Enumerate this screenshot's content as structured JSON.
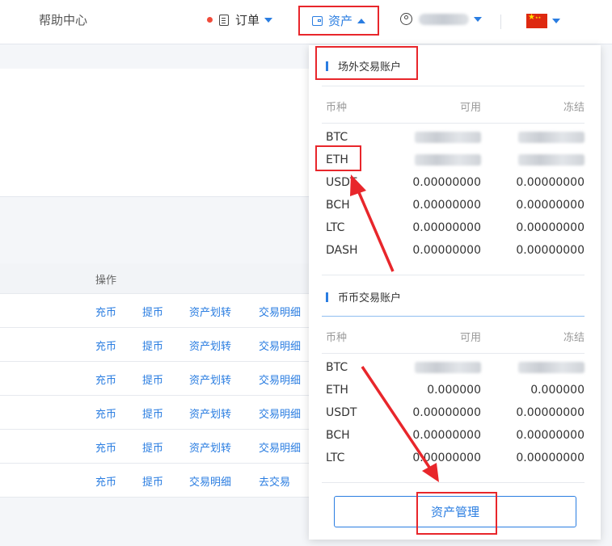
{
  "nav": {
    "help": "帮助中心",
    "orders": "订单",
    "assets": "资产"
  },
  "table": {
    "action_header": "操作",
    "rows": [
      [
        "充币",
        "提币",
        "资产划转",
        "交易明细"
      ],
      [
        "充币",
        "提币",
        "资产划转",
        "交易明细"
      ],
      [
        "充币",
        "提币",
        "资产划转",
        "交易明细"
      ],
      [
        "充币",
        "提币",
        "资产划转",
        "交易明细"
      ],
      [
        "充币",
        "提币",
        "资产划转",
        "交易明细"
      ],
      [
        "充币",
        "提币",
        "交易明细",
        "去交易"
      ]
    ]
  },
  "dropdown": {
    "otc_title": "场外交易账户",
    "spot_title": "币币交易账户",
    "col_coin": "币种",
    "col_available": "可用",
    "col_frozen": "冻结",
    "otc_rows": [
      {
        "coin": "BTC",
        "available": "",
        "frozen": ""
      },
      {
        "coin": "ETH",
        "available": "",
        "frozen": ""
      },
      {
        "coin": "USDT",
        "available": "0.00000000",
        "frozen": "0.00000000"
      },
      {
        "coin": "BCH",
        "available": "0.00000000",
        "frozen": "0.00000000"
      },
      {
        "coin": "LTC",
        "available": "0.00000000",
        "frozen": "0.00000000"
      },
      {
        "coin": "DASH",
        "available": "0.00000000",
        "frozen": "0.00000000"
      }
    ],
    "spot_rows": [
      {
        "coin": "BTC",
        "available": "",
        "frozen": ""
      },
      {
        "coin": "ETH",
        "available": "0.000000",
        "frozen": "0.000000"
      },
      {
        "coin": "USDT",
        "available": "0.00000000",
        "frozen": "0.00000000"
      },
      {
        "coin": "BCH",
        "available": "0.00000000",
        "frozen": "0.00000000"
      },
      {
        "coin": "LTC",
        "available": "0.00000000",
        "frozen": "0.00000000"
      }
    ],
    "manage_button": "资产管理"
  },
  "colors": {
    "accent": "#2a7de1",
    "highlight": "#e8262b"
  },
  "icons": {
    "orders": "document-icon",
    "assets": "wallet-icon",
    "user": "user-icon",
    "language": "china-flag-icon"
  }
}
